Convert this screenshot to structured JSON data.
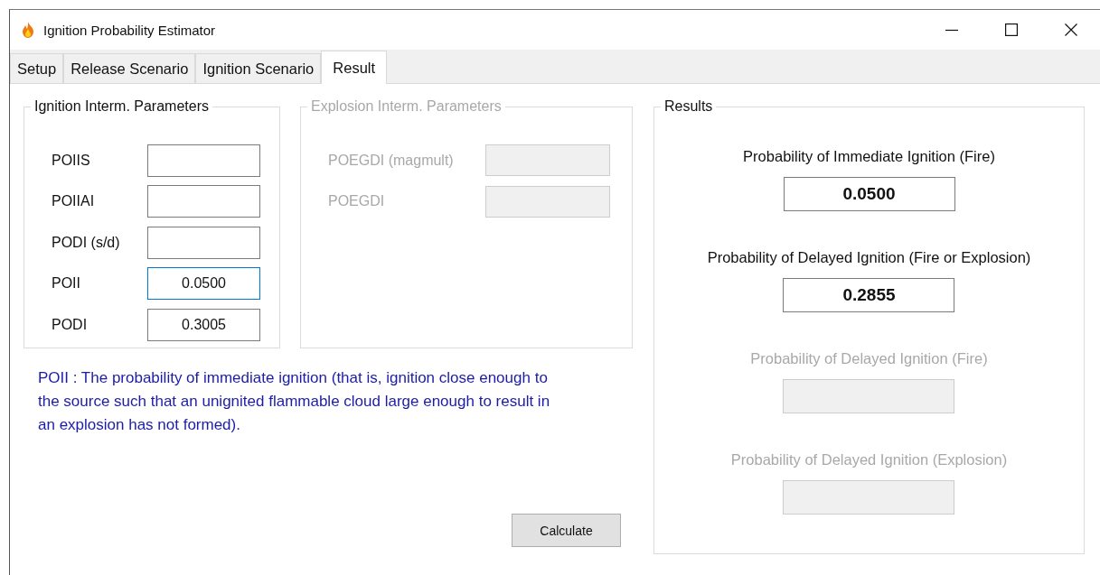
{
  "window": {
    "title": "Ignition Probability Estimator"
  },
  "tabs": [
    {
      "label": "Setup",
      "selected": false
    },
    {
      "label": "Release Scenario",
      "selected": false
    },
    {
      "label": "Ignition Scenario",
      "selected": false
    },
    {
      "label": "Result",
      "selected": true
    }
  ],
  "ignition_group": {
    "title": "Ignition Interm. Parameters",
    "disabled": false,
    "fields": [
      {
        "label": "POIIS",
        "focused": false
      },
      {
        "label": "POIIAI",
        "focused": false
      },
      {
        "label": "PODI (s/d)",
        "focused": false
      },
      {
        "label": "POII",
        "value": "0.0500",
        "focused": true
      },
      {
        "label": "PODI",
        "value": "0.3005",
        "focused": false
      }
    ]
  },
  "explosion_group": {
    "title": "Explosion Interm. Parameters",
    "disabled": true,
    "fields": [
      {
        "label": "POEGDI (magmult)"
      },
      {
        "label": "POEGDI"
      }
    ]
  },
  "note": "POII : The probability of immediate ignition (that is, ignition close enough to the source such that an unignited flammable cloud large enough to result in an explosion has not formed).",
  "calculate_button": "Calculate",
  "results": {
    "title": "Results",
    "items": [
      {
        "label": "Probability of Immediate Ignition (Fire)",
        "value": "0.0500",
        "disabled": false
      },
      {
        "label": "Probability of Delayed Ignition (Fire or Explosion)",
        "value": "0.2855",
        "disabled": false
      },
      {
        "label": "Probability of Delayed Ignition (Fire)",
        "disabled": true
      },
      {
        "label": "Probability of Delayed Ignition (Explosion)",
        "disabled": true
      }
    ]
  }
}
